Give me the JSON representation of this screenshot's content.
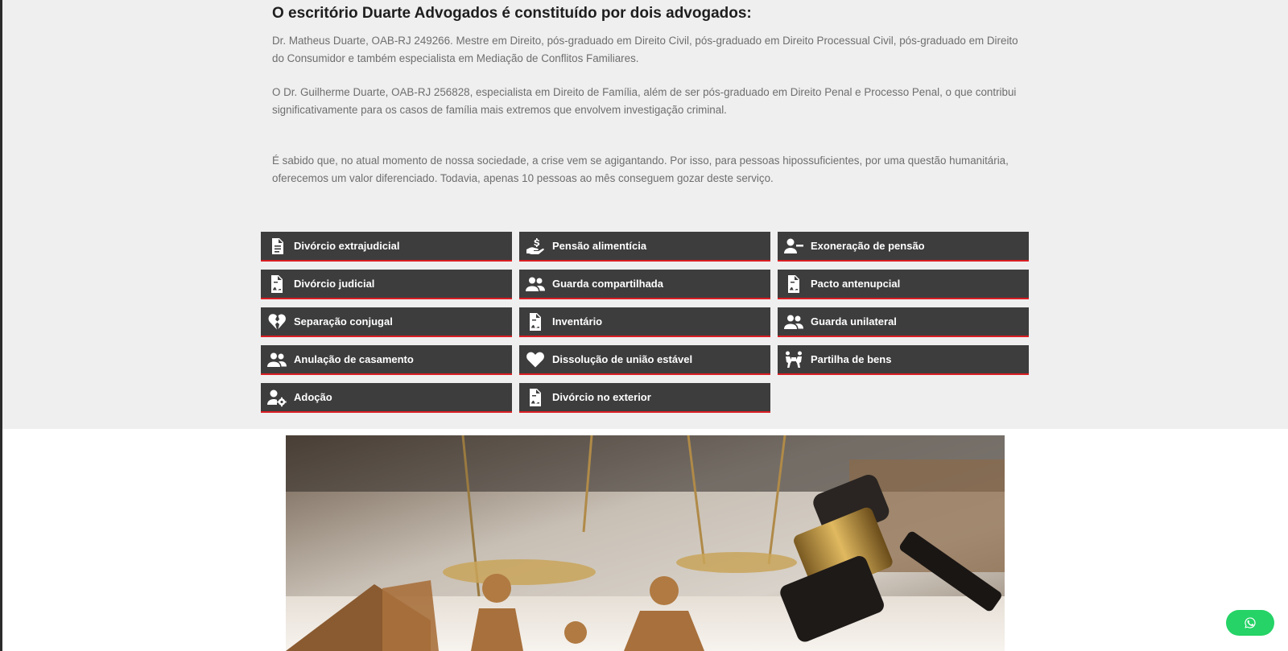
{
  "about": {
    "heading": "O escritório Duarte Advogados é constituído por dois advogados:",
    "paragraphs": [
      "Dr. Matheus Duarte, OAB-RJ 249266. Mestre em Direito, pós-graduado em Direito Civil, pós-graduado em Direito Processual Civil, pós-graduado em Direito do Consumidor e também especialista em Mediação de Conflitos Familiares.",
      "O Dr. Guilherme Duarte, OAB-RJ 256828, especialista em Direito de Família, além de ser pós-graduado em Direito Penal e Processo Penal, o que contribui significativamente para os casos de família mais extremos que envolvem investigação criminal.",
      "É sabido que, no atual momento de nossa sociedade, a crise vem se agigantando. Por isso, para pessoas hipossuficientes, por uma questão humanitária, oferecemos um valor diferenciado. Todavia, apenas 10 pessoas ao mês conseguem gozar deste serviço."
    ]
  },
  "services": [
    {
      "label": "Divórcio extrajudicial",
      "icon": "document-icon"
    },
    {
      "label": "Pensão alimentícia",
      "icon": "hand-money-icon"
    },
    {
      "label": "Exoneração de pensão",
      "icon": "user-minus-icon"
    },
    {
      "label": "Divórcio judicial",
      "icon": "contract-icon"
    },
    {
      "label": "Guarda compartilhada",
      "icon": "users-icon"
    },
    {
      "label": "Pacto antenupcial",
      "icon": "contract-icon"
    },
    {
      "label": "Separação conjugal",
      "icon": "broken-heart-icon"
    },
    {
      "label": "Inventário",
      "icon": "contract-icon"
    },
    {
      "label": "Guarda unilateral",
      "icon": "users-icon"
    },
    {
      "label": "Anulação de casamento",
      "icon": "users-icon"
    },
    {
      "label": "Dissolução de união estável",
      "icon": "heart-icon"
    },
    {
      "label": "Partilha de bens",
      "icon": "people-carry-icon"
    },
    {
      "label": "Adoção",
      "icon": "user-cog-icon"
    },
    {
      "label": "Divórcio no exterior",
      "icon": "contract-icon"
    }
  ],
  "colors": {
    "button_bg": "#3e3d3d",
    "button_border": "#d91e24",
    "section_bg": "#efefef",
    "whatsapp": "#25d366"
  },
  "whatsapp": {
    "icon": "whatsapp-icon"
  },
  "hero_image": {
    "icon": "scales-gavel-family-image"
  }
}
